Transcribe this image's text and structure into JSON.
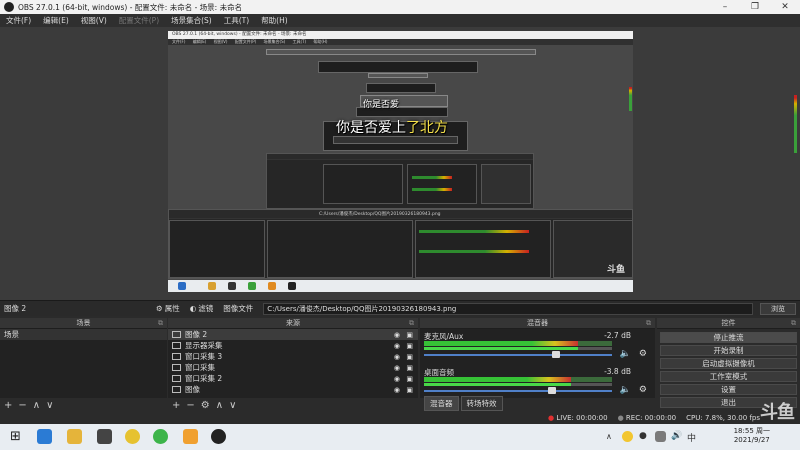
{
  "window": {
    "title": "OBS 27.0.1 (64-bit, windows) - 配置文件: 未命名 - 场景: 未命名",
    "minimize": "–",
    "maximize": "❐",
    "close": "✕"
  },
  "menu": [
    "文件(F)",
    "编辑(E)",
    "视图(V)",
    "配置文件(P)",
    "场景集合(S)",
    "工具(T)",
    "帮助(H)"
  ],
  "preview": {
    "nested_title": "OBS 27.0.1 (64-bit, windows) - 配置文件: 未命名 - 场景: 未命名",
    "nested_menu": "文件(F) 编辑(E) 视图(V) 配置文件(P) 场景集合(S) 工具(T) 帮助(H)",
    "lyric_small": "你是否爱",
    "lyric_large_a": "你是否爱上",
    "lyric_large_b": "了北方",
    "nested_path": "C:/Users/潘俊杰/Desktop/QQ图片20190326180943.png",
    "nested_badge": "斗鱼"
  },
  "infobar": {
    "source_name": "图像 2",
    "properties_label": "属性",
    "filters_label": "滤镜",
    "image_file_label": "图像文件",
    "path": "C:/Users/潘俊杰/Desktop/QQ图片20190326180943.png",
    "browse_label": "浏览"
  },
  "scenes": {
    "header": "场景",
    "items": [
      "场景"
    ]
  },
  "sources": {
    "header": "来源",
    "items": [
      "图像 2",
      "显示器采集",
      "窗口采集 3",
      "窗口采集",
      "窗口采集 2",
      "图像"
    ]
  },
  "mixer": {
    "header": "混音器",
    "channels": [
      {
        "name": "麦克风/Aux",
        "db": "-2.7 dB",
        "level": 0.82,
        "volume": 0.7
      },
      {
        "name": "桌面音频",
        "db": "-3.8 dB",
        "level": 0.78,
        "volume": 0.68
      }
    ],
    "tabs": [
      "混音器",
      "转场特效"
    ]
  },
  "controls": {
    "header": "控件",
    "buttons": [
      "停止推流",
      "开始录制",
      "启动虚拟摄像机",
      "工作室模式",
      "设置",
      "退出"
    ]
  },
  "dock_footer_icons": {
    "add": "+",
    "remove": "−",
    "up": "∧",
    "down": "∨",
    "gear": "⚙"
  },
  "status": {
    "live": "LIVE: 00:00:00",
    "rec": "REC: 00:00:00",
    "cpu": "CPU: 7.8%, 30.00 fps"
  },
  "taskbar": {
    "time": "18:55 周一",
    "date": "2021/9/27"
  },
  "watermark": "斗鱼",
  "colors": {
    "accent_red": "#e23030",
    "meter_green": "#36c236",
    "meter_yellow": "#d8c21e",
    "slider_blue": "#5080c8"
  }
}
